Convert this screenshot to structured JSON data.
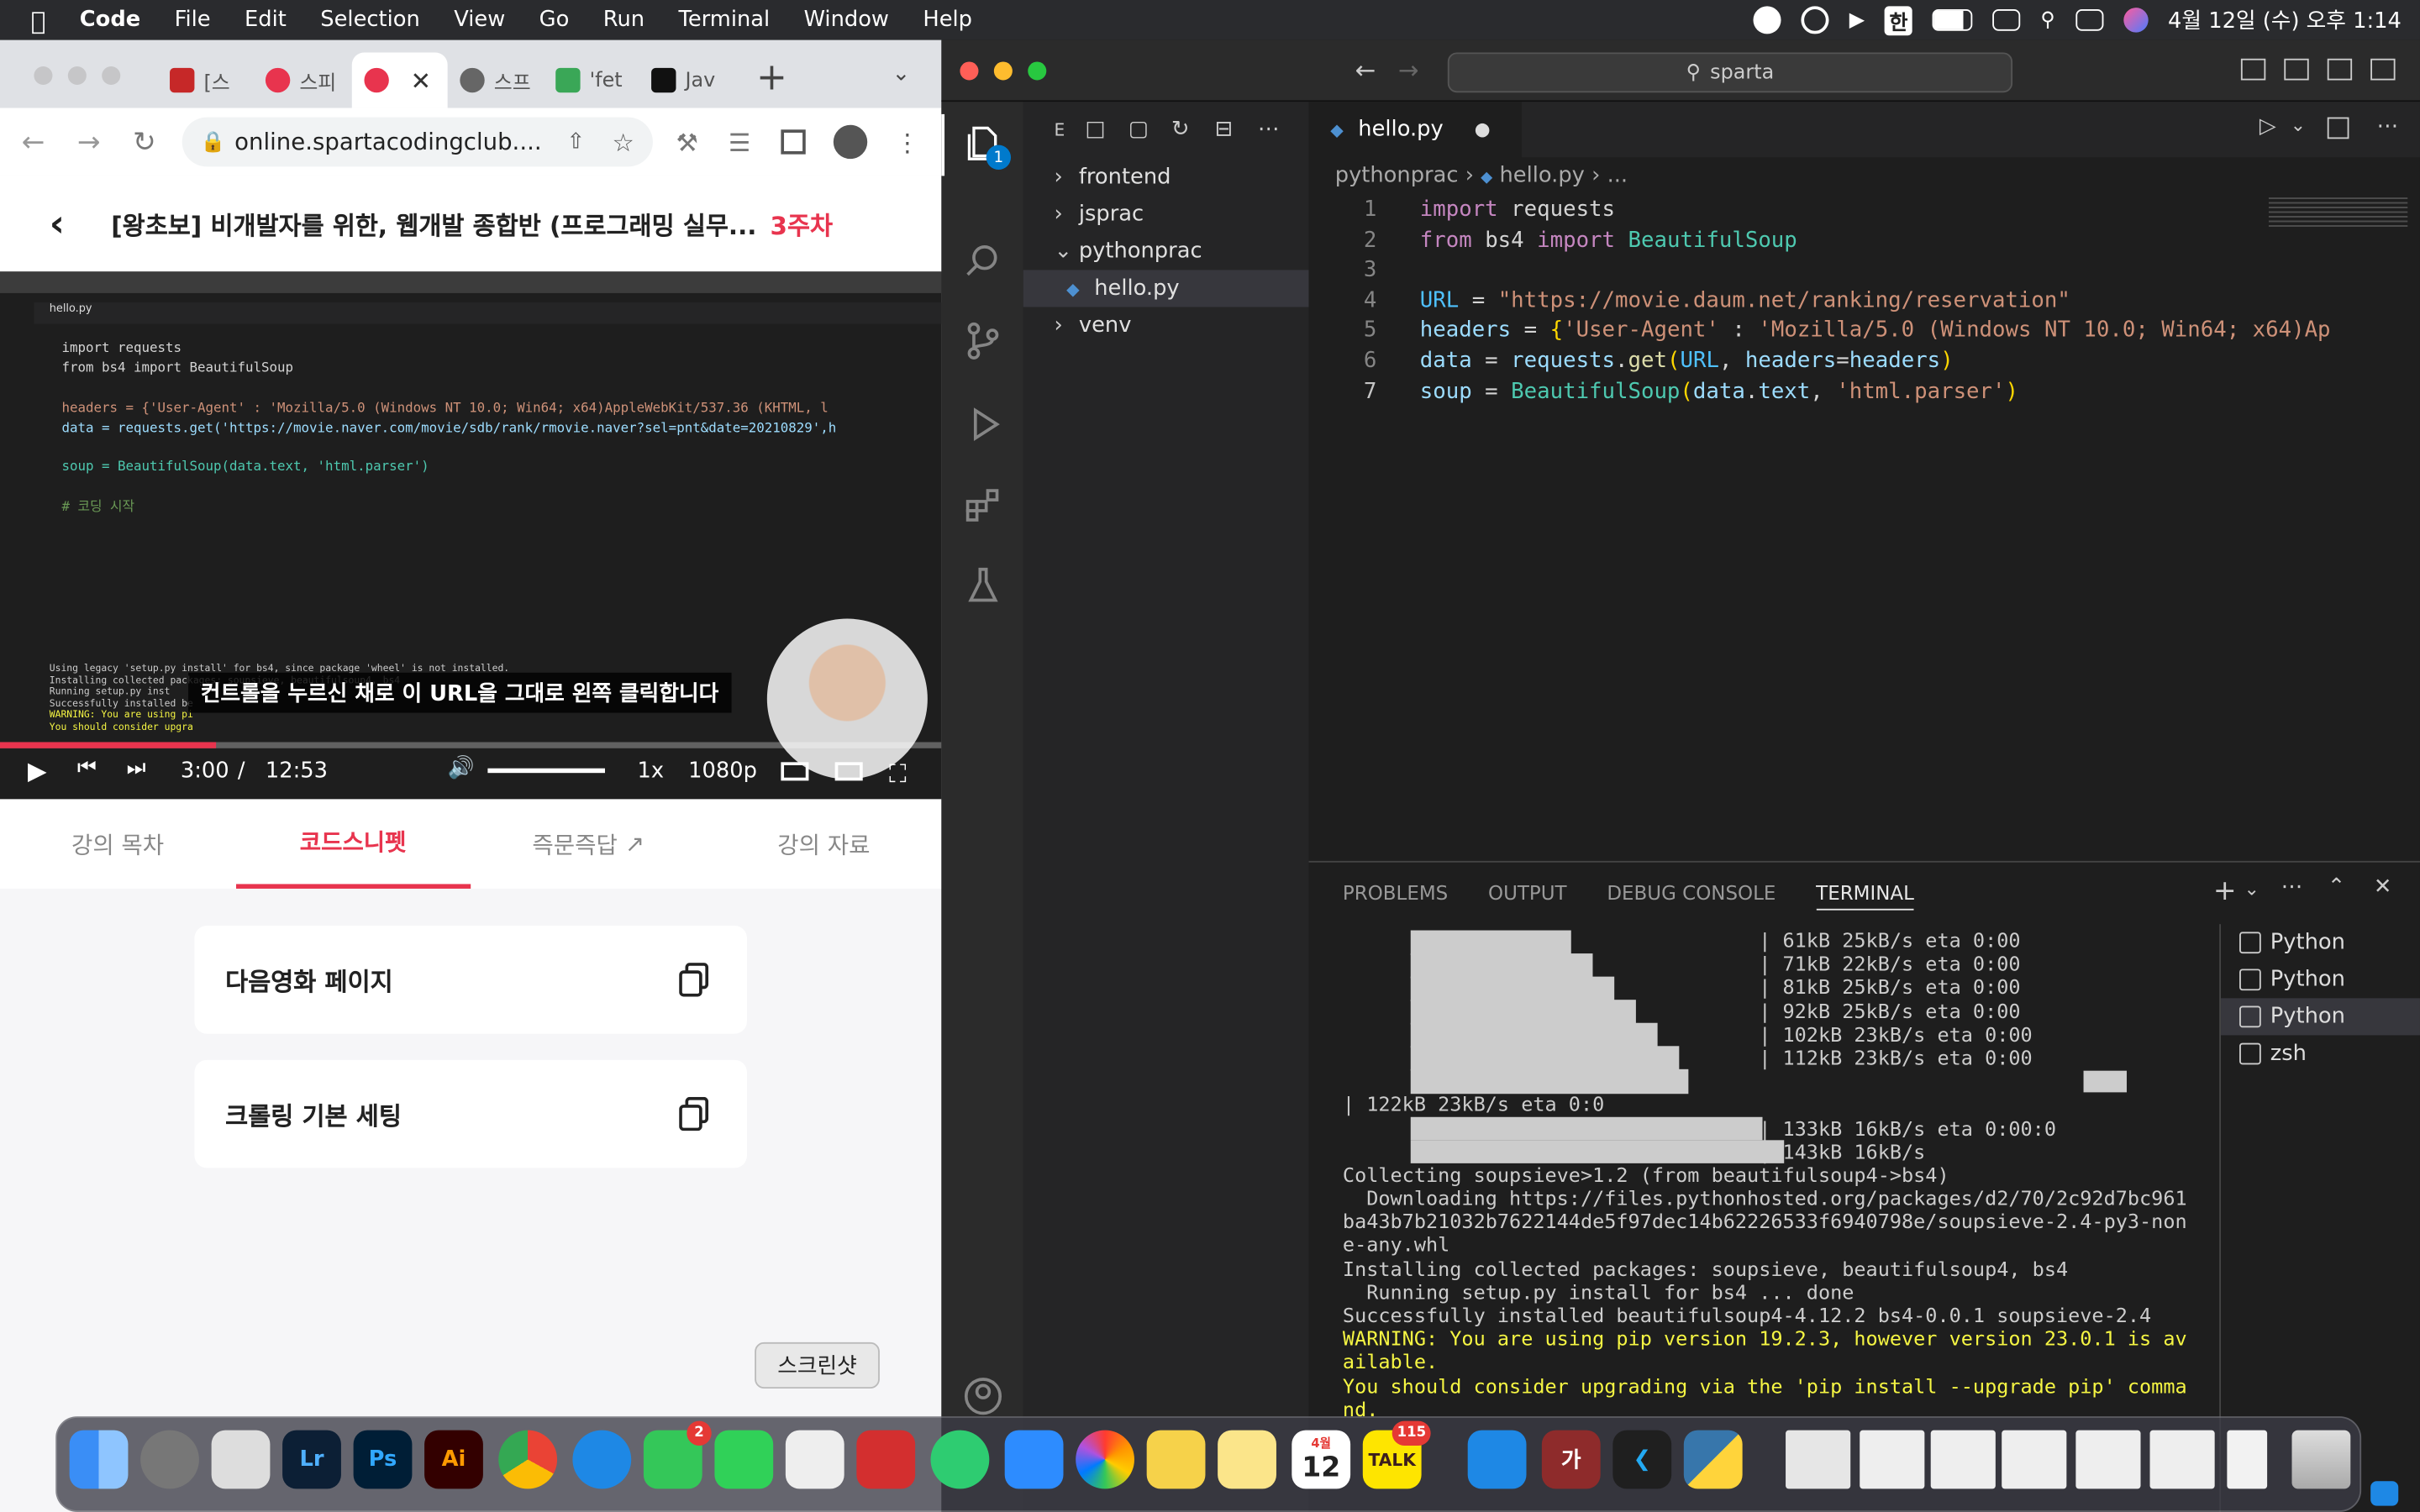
{
  "menubar": {
    "items": [
      "Code",
      "File",
      "Edit",
      "Selection",
      "View",
      "Go",
      "Run",
      "Terminal",
      "Window",
      "Help"
    ],
    "ime": "한",
    "datetime": "4월 12일 (수) 오후 1:14"
  },
  "chrome": {
    "tabs": [
      {
        "label": "[스"
      },
      {
        "label": "스피"
      },
      {
        "label": ""
      },
      {
        "label": "스프"
      },
      {
        "label": "'fet"
      },
      {
        "label": "Jav"
      }
    ],
    "url": "online.spartacodingclub....",
    "course": {
      "title": "[왕초보] 비개발자를 위한, 웹개발 종합반 (프로그래밍 실무...",
      "week": "3주차"
    },
    "video": {
      "caption": "컨트롤을 누르신 채로 이 URL을 그대로 왼쪽 클릭합니다",
      "time_current": "3:00",
      "time_sep": "/",
      "time_total": "12:53",
      "speed": "1x",
      "quality": "1080p",
      "code": [
        "import requests",
        "from bs4 import BeautifulSoup",
        "",
        "headers = {'User-Agent' : 'Mozilla/5.0 (Windows NT 10.0; Win64; x64)AppleWebKit/537.36 (KHTML, l",
        "data = requests.get('https://movie.naver.com/movie/sdb/rank/rmovie.naver?sel=pnt&date=20210829',h",
        "",
        "soup = BeautifulSoup(data.text, 'html.parser')",
        "",
        "# 코딩 시작"
      ],
      "term_lines": [
        "Using legacy 'setup.py install' for bs4, since package 'wheel' is not installed.",
        "Installing collected packages: soupsieve, beautifulsoup4, bs4",
        "  Running setup.py inst",
        "Successfully installed be",
        "WARNING: You are using pi",
        "You should consider upgra"
      ]
    },
    "tabs2": [
      "강의 목차",
      "코드스니펫",
      "즉문즉답",
      "강의 자료"
    ],
    "cards": [
      "다음영화 페이지",
      "크롤링 기본 세팅"
    ]
  },
  "vscode": {
    "search": "sparta",
    "explorer_header": "E",
    "tree": [
      {
        "label": "frontend"
      },
      {
        "label": "jsprac"
      },
      {
        "label": "pythonprac"
      },
      {
        "label": "hello.py"
      },
      {
        "label": "venv"
      }
    ],
    "tab": "hello.py",
    "breadcrumb": {
      "folder": "pythonprac",
      "file": "hello.py",
      "rest": "..."
    },
    "explorer_badge": "1",
    "lines": [
      [
        {
          "t": "import ",
          "c": "kw"
        },
        {
          "t": "requests",
          "c": ""
        }
      ],
      [
        {
          "t": "from ",
          "c": "kw"
        },
        {
          "t": "bs4 ",
          "c": ""
        },
        {
          "t": "import ",
          "c": "kw"
        },
        {
          "t": "BeautifulSoup",
          "c": "cls"
        }
      ],
      [],
      [
        {
          "t": "URL",
          "c": "cs"
        },
        {
          "t": " = ",
          "c": ""
        },
        {
          "t": "\"https://movie.daum.net/ranking/reservation\"",
          "c": "st"
        }
      ],
      [
        {
          "t": "headers",
          "c": "vr"
        },
        {
          "t": " = ",
          "c": ""
        },
        {
          "t": "{",
          "c": "pu"
        },
        {
          "t": "'User-Agent'",
          "c": "st"
        },
        {
          "t": " : ",
          "c": ""
        },
        {
          "t": "'Mozilla/5.0 (Windows NT 10.0; Win64; x64)Ap",
          "c": "st"
        }
      ],
      [
        {
          "t": "data",
          "c": "vr"
        },
        {
          "t": " = ",
          "c": ""
        },
        {
          "t": "requests",
          "c": "vr"
        },
        {
          "t": ".",
          "c": ""
        },
        {
          "t": "get",
          "c": "fn"
        },
        {
          "t": "(",
          "c": "pu"
        },
        {
          "t": "URL",
          "c": "cs"
        },
        {
          "t": ", ",
          "c": ""
        },
        {
          "t": "headers",
          "c": "vr"
        },
        {
          "t": "=",
          "c": ""
        },
        {
          "t": "headers",
          "c": "vr"
        },
        {
          "t": ")",
          "c": "pu"
        }
      ],
      [
        {
          "t": "soup",
          "c": "vr"
        },
        {
          "t": " = ",
          "c": ""
        },
        {
          "t": "BeautifulSoup",
          "c": "cls"
        },
        {
          "t": "(",
          "c": "pu"
        },
        {
          "t": "data",
          "c": "vr"
        },
        {
          "t": ".",
          "c": ""
        },
        {
          "t": "text",
          "c": "vr"
        },
        {
          "t": ", ",
          "c": ""
        },
        {
          "t": "'html.parser'",
          "c": "st"
        },
        {
          "t": ")",
          "c": "pu"
        }
      ]
    ],
    "panel_tabs": [
      "PROBLEMS",
      "OUTPUT",
      "DEBUG CONSOLE",
      "TERMINAL"
    ],
    "terminal": [
      {
        "t": "                                   | 61kB 25kB/s eta 0:00"
      },
      {
        "t": "                                   | 71kB 22kB/s eta 0:00"
      },
      {
        "t": "                                   | 81kB 25kB/s eta 0:00"
      },
      {
        "t": "                                   | 92kB 25kB/s eta 0:00"
      },
      {
        "t": "                                   | 102kB 23kB/s eta 0:00"
      },
      {
        "t": "                                   | 112kB 23kB/s eta 0:00"
      },
      {
        "t": ""
      },
      {
        "t": "| 122kB 23kB/s eta 0:0"
      },
      {
        "t": "                                   | 133kB 16kB/s eta 0:00:0"
      },
      {
        "t": "                                   | 143kB 16kB/s"
      },
      {
        "t": "Collecting soupsieve>1.2 (from beautifulsoup4->bs4)"
      },
      {
        "t": "  Downloading https://files.pythonhosted.org/packages/d2/70/2c92d7bc961"
      },
      {
        "t": "ba43b7b21032b7622144de5f97dec14b62226533f6940798e/soupsieve-2.4-py3-non"
      },
      {
        "t": "e-any.whl"
      },
      {
        "t": "Installing collected packages: soupsieve, beautifulsoup4, bs4"
      },
      {
        "t": "  Running setup.py install for bs4 ... done"
      },
      {
        "t": "Successfully installed beautifulsoup4-4.12.2 bs4-0.0.1 soupsieve-2.4"
      },
      {
        "t": "WARNING: You are using pip version 19.2.3, however version 23.0.1 is av",
        "y": true
      },
      {
        "t": "ailable.",
        "y": true
      },
      {
        "t": "You should consider upgrading via the 'pip install --upgrade pip' comma",
        "y": true
      },
      {
        "t": "nd.",
        "y": true
      }
    ],
    "terminal_list": [
      "Python",
      "Python",
      "Python",
      "zsh"
    ]
  },
  "dock": {
    "tooltip": "스크린샷",
    "calendar_month": "4월",
    "calendar_day": "12",
    "messages_badge": "2",
    "talk_label": "TALK",
    "talk_badge": "115",
    "lr": "Lr",
    "ps": "Ps",
    "ai": "Ai",
    "ga": "가"
  },
  "colors": {
    "accent": "#e8344e",
    "vscode_blue": "#007acc"
  }
}
